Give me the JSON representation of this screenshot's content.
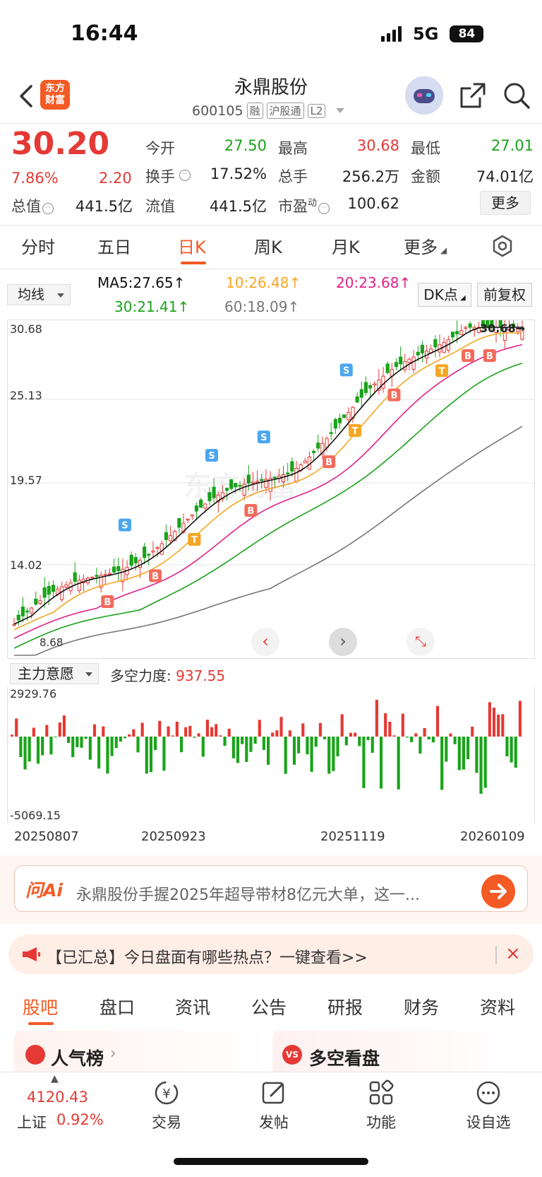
{
  "status": {
    "time": "16:44",
    "network": "5G",
    "battery": "84"
  },
  "header": {
    "logo_line1": "东方",
    "logo_line2": "财富",
    "title": "永鼎股份",
    "code": "600105",
    "tags": [
      "融",
      "沪股通",
      "L2"
    ]
  },
  "quote": {
    "price": "30.20",
    "change_pct": "7.86%",
    "change": "2.20",
    "rows": [
      [
        {
          "label": "今开",
          "value": "27.50",
          "color": "green"
        },
        {
          "label": "最高",
          "value": "30.68",
          "color": "red"
        },
        {
          "label": "最低",
          "value": "27.01",
          "color": "green"
        }
      ],
      [
        {
          "label": "换手",
          "value": "17.52%",
          "color": "dark"
        },
        {
          "label": "总手",
          "value": "256.2万",
          "color": "dark"
        },
        {
          "label": "金额",
          "value": "74.01亿",
          "color": "dark"
        }
      ]
    ],
    "total_mv_label": "总值",
    "total_mv": "441.5亿",
    "float_mv_label": "流值",
    "float_mv": "441.5亿",
    "pe_label": "市盈",
    "pe_sup": "动",
    "pe": "100.62",
    "more_label": "更多"
  },
  "period_tabs": [
    "分时",
    "五日",
    "日K",
    "周K",
    "月K",
    "更多"
  ],
  "active_period": "日K",
  "ma": {
    "select_label": "均线",
    "ma5": "MA5:27.65↑",
    "ma10": "10:26.48↑",
    "ma20": "20:23.68↑",
    "ma30": "30:21.41↑",
    "ma60": "60:18.09↑",
    "dk_label": "DK点",
    "fq_label": "前复权",
    "colors": {
      "ma5": "#111111",
      "ma10": "#f5a623",
      "ma20": "#e0218a",
      "ma30": "#1aa31a",
      "ma60": "#777777"
    }
  },
  "kline": {
    "y_labels": [
      "30.68",
      "25.13",
      "19.57",
      "14.02"
    ],
    "max_label": "30.68→",
    "min_label": "8.68",
    "watermark": "东方财富"
  },
  "indicator": {
    "select_label": "主力意愿",
    "metric_label": "多空力度:",
    "metric_value": "937.55",
    "y_top": "2929.76",
    "y_bottom": "-5069.15"
  },
  "dates": [
    "20250807",
    "20250923",
    "20251119",
    "20260109"
  ],
  "ai": {
    "logo": "问Ai",
    "text": "永鼎股份手握2025年超导带材8亿元大单，这一..."
  },
  "notice": {
    "text": "【已汇总】今日盘面有哪些热点？一键查看>>",
    "close": "×"
  },
  "bottom_tabs": [
    "股吧",
    "盘口",
    "资讯",
    "公告",
    "研报",
    "财务",
    "资料"
  ],
  "active_bottom_tab": "股吧",
  "cards": {
    "left": "人气榜",
    "right": "多空看盘"
  },
  "index": {
    "value": "4120.43",
    "name": "上证",
    "pct": "0.92%"
  },
  "bottom_nav": [
    "交易",
    "发帖",
    "功能",
    "设自选"
  ]
}
